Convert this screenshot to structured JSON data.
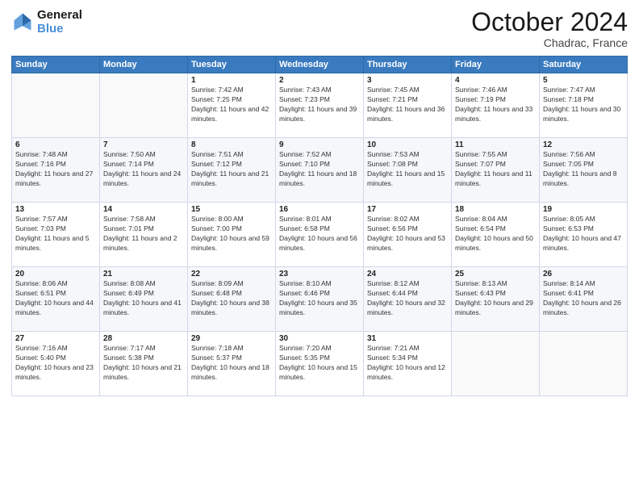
{
  "header": {
    "logo_line1": "General",
    "logo_line2": "Blue",
    "month": "October 2024",
    "location": "Chadrac, France"
  },
  "weekdays": [
    "Sunday",
    "Monday",
    "Tuesday",
    "Wednesday",
    "Thursday",
    "Friday",
    "Saturday"
  ],
  "weeks": [
    [
      {
        "day": "",
        "info": ""
      },
      {
        "day": "",
        "info": ""
      },
      {
        "day": "1",
        "info": "Sunrise: 7:42 AM\nSunset: 7:25 PM\nDaylight: 11 hours and 42 minutes."
      },
      {
        "day": "2",
        "info": "Sunrise: 7:43 AM\nSunset: 7:23 PM\nDaylight: 11 hours and 39 minutes."
      },
      {
        "day": "3",
        "info": "Sunrise: 7:45 AM\nSunset: 7:21 PM\nDaylight: 11 hours and 36 minutes."
      },
      {
        "day": "4",
        "info": "Sunrise: 7:46 AM\nSunset: 7:19 PM\nDaylight: 11 hours and 33 minutes."
      },
      {
        "day": "5",
        "info": "Sunrise: 7:47 AM\nSunset: 7:18 PM\nDaylight: 11 hours and 30 minutes."
      }
    ],
    [
      {
        "day": "6",
        "info": "Sunrise: 7:48 AM\nSunset: 7:16 PM\nDaylight: 11 hours and 27 minutes."
      },
      {
        "day": "7",
        "info": "Sunrise: 7:50 AM\nSunset: 7:14 PM\nDaylight: 11 hours and 24 minutes."
      },
      {
        "day": "8",
        "info": "Sunrise: 7:51 AM\nSunset: 7:12 PM\nDaylight: 11 hours and 21 minutes."
      },
      {
        "day": "9",
        "info": "Sunrise: 7:52 AM\nSunset: 7:10 PM\nDaylight: 11 hours and 18 minutes."
      },
      {
        "day": "10",
        "info": "Sunrise: 7:53 AM\nSunset: 7:08 PM\nDaylight: 11 hours and 15 minutes."
      },
      {
        "day": "11",
        "info": "Sunrise: 7:55 AM\nSunset: 7:07 PM\nDaylight: 11 hours and 11 minutes."
      },
      {
        "day": "12",
        "info": "Sunrise: 7:56 AM\nSunset: 7:05 PM\nDaylight: 11 hours and 8 minutes."
      }
    ],
    [
      {
        "day": "13",
        "info": "Sunrise: 7:57 AM\nSunset: 7:03 PM\nDaylight: 11 hours and 5 minutes."
      },
      {
        "day": "14",
        "info": "Sunrise: 7:58 AM\nSunset: 7:01 PM\nDaylight: 11 hours and 2 minutes."
      },
      {
        "day": "15",
        "info": "Sunrise: 8:00 AM\nSunset: 7:00 PM\nDaylight: 10 hours and 59 minutes."
      },
      {
        "day": "16",
        "info": "Sunrise: 8:01 AM\nSunset: 6:58 PM\nDaylight: 10 hours and 56 minutes."
      },
      {
        "day": "17",
        "info": "Sunrise: 8:02 AM\nSunset: 6:56 PM\nDaylight: 10 hours and 53 minutes."
      },
      {
        "day": "18",
        "info": "Sunrise: 8:04 AM\nSunset: 6:54 PM\nDaylight: 10 hours and 50 minutes."
      },
      {
        "day": "19",
        "info": "Sunrise: 8:05 AM\nSunset: 6:53 PM\nDaylight: 10 hours and 47 minutes."
      }
    ],
    [
      {
        "day": "20",
        "info": "Sunrise: 8:06 AM\nSunset: 6:51 PM\nDaylight: 10 hours and 44 minutes."
      },
      {
        "day": "21",
        "info": "Sunrise: 8:08 AM\nSunset: 6:49 PM\nDaylight: 10 hours and 41 minutes."
      },
      {
        "day": "22",
        "info": "Sunrise: 8:09 AM\nSunset: 6:48 PM\nDaylight: 10 hours and 38 minutes."
      },
      {
        "day": "23",
        "info": "Sunrise: 8:10 AM\nSunset: 6:46 PM\nDaylight: 10 hours and 35 minutes."
      },
      {
        "day": "24",
        "info": "Sunrise: 8:12 AM\nSunset: 6:44 PM\nDaylight: 10 hours and 32 minutes."
      },
      {
        "day": "25",
        "info": "Sunrise: 8:13 AM\nSunset: 6:43 PM\nDaylight: 10 hours and 29 minutes."
      },
      {
        "day": "26",
        "info": "Sunrise: 8:14 AM\nSunset: 6:41 PM\nDaylight: 10 hours and 26 minutes."
      }
    ],
    [
      {
        "day": "27",
        "info": "Sunrise: 7:16 AM\nSunset: 5:40 PM\nDaylight: 10 hours and 23 minutes."
      },
      {
        "day": "28",
        "info": "Sunrise: 7:17 AM\nSunset: 5:38 PM\nDaylight: 10 hours and 21 minutes."
      },
      {
        "day": "29",
        "info": "Sunrise: 7:18 AM\nSunset: 5:37 PM\nDaylight: 10 hours and 18 minutes."
      },
      {
        "day": "30",
        "info": "Sunrise: 7:20 AM\nSunset: 5:35 PM\nDaylight: 10 hours and 15 minutes."
      },
      {
        "day": "31",
        "info": "Sunrise: 7:21 AM\nSunset: 5:34 PM\nDaylight: 10 hours and 12 minutes."
      },
      {
        "day": "",
        "info": ""
      },
      {
        "day": "",
        "info": ""
      }
    ]
  ]
}
